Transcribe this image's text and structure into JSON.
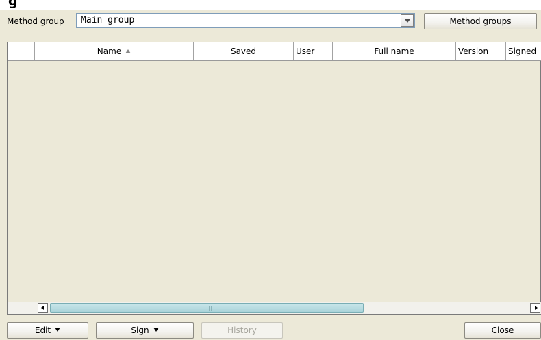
{
  "window": {
    "title_partial": "g"
  },
  "toolbar": {
    "method_group_label": "Method group",
    "method_group_value": "Main group",
    "method_groups_button": "Method groups"
  },
  "table": {
    "columns": [
      "",
      "Name",
      "Saved",
      "User",
      "Full name",
      "Version",
      "Signed"
    ],
    "sorted_column": "Name",
    "sort_direction": "ascending",
    "rows": []
  },
  "scrollbar": {
    "horizontal_position": 0.0,
    "visible_fraction": 0.6
  },
  "bottom_buttons": {
    "edit": "Edit",
    "sign": "Sign",
    "history": "History",
    "close": "Close"
  },
  "icons": {
    "dropdown": "chevron-down-icon",
    "sort": "sort-ascending-icon",
    "menu_arrow": "triangle-down-icon",
    "scroll_left": "arrow-left-icon",
    "scroll_right": "arrow-right-icon"
  }
}
